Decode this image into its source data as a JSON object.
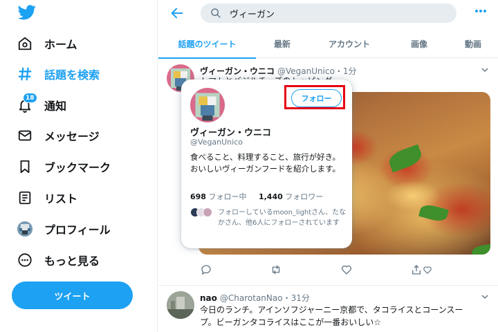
{
  "colors": {
    "accent": "#1da1f2",
    "highlight_box": "#e60012",
    "text": "#14171a",
    "secondary": "#657786"
  },
  "sidebar": {
    "logo_icon": "twitter-bird-icon",
    "items": [
      {
        "label": "ホーム",
        "icon": "home-icon"
      },
      {
        "label": "話題を検索",
        "icon": "hashtag-icon",
        "active": true
      },
      {
        "label": "通知",
        "icon": "bell-icon",
        "badge": "18"
      },
      {
        "label": "メッセージ",
        "icon": "envelope-icon"
      },
      {
        "label": "ブックマーク",
        "icon": "bookmark-icon"
      },
      {
        "label": "リスト",
        "icon": "list-icon"
      },
      {
        "label": "プロフィール",
        "icon": "avatar"
      },
      {
        "label": "もっと見る",
        "icon": "more-circle-icon"
      }
    ],
    "tweet_button": "ツイート"
  },
  "header": {
    "search_value": "ヴィーガン"
  },
  "tabs": [
    {
      "label": "話題のツイート",
      "active": true
    },
    {
      "label": "最新"
    },
    {
      "label": "アカウント"
    },
    {
      "label": "画像"
    },
    {
      "label": "動画"
    }
  ],
  "tweet1": {
    "name": "ヴィーガン・ウニコ",
    "handle": "@VeganUnico",
    "time": "・1分",
    "text": "トマトとバジルチーズのトッピング"
  },
  "hover_card": {
    "follow_button": "フォロー",
    "name": "ヴィーガン・ウニコ",
    "handle": "@VeganUnico",
    "bio": "食べること、料理すること、旅行が好き。おいしいヴィーガンフードを紹介します。",
    "following_count": "698",
    "following_label": "フォロー中",
    "followers_count": "1,440",
    "followers_label": "フォロワー",
    "known_followers": "フォローしているmoon_lightさん、たなかさん、他6人にフォローされています"
  },
  "tweet2": {
    "name": "nao",
    "handle": "@CharotanNao",
    "time": "・31分",
    "text_line1": "今日のランチ。アインソフジャーニー京都で、タコライスとコーンスー",
    "text_line2": "プ。ビーガンタコライスはここが一番おいしい☆"
  }
}
